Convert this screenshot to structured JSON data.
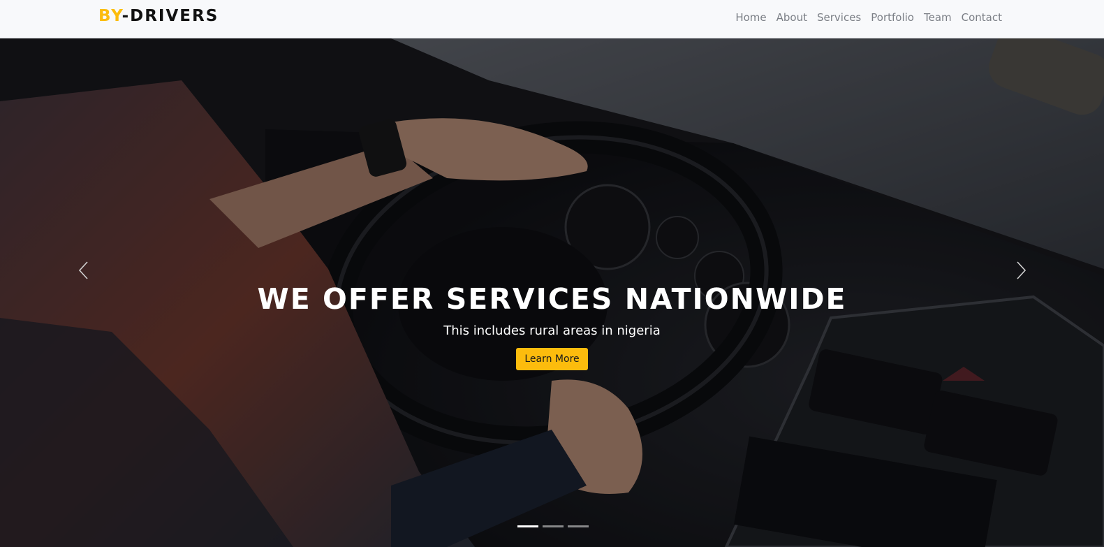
{
  "brand": {
    "part1": "BY",
    "part2": "-DRIVERS",
    "accent_color": "#fcbc0d"
  },
  "nav": {
    "items": [
      {
        "label": "Home"
      },
      {
        "label": "About"
      },
      {
        "label": "Services"
      },
      {
        "label": "Portfolio"
      },
      {
        "label": "Team"
      },
      {
        "label": "Contact"
      }
    ]
  },
  "hero": {
    "title": "WE OFFER SERVICES NATIONWIDE",
    "subtitle": "This includes rural areas in nigeria",
    "cta_label": "Learn More",
    "prev_icon": "chevron-left-icon",
    "next_icon": "chevron-right-icon",
    "slide_count": 3,
    "active_slide": 1
  }
}
